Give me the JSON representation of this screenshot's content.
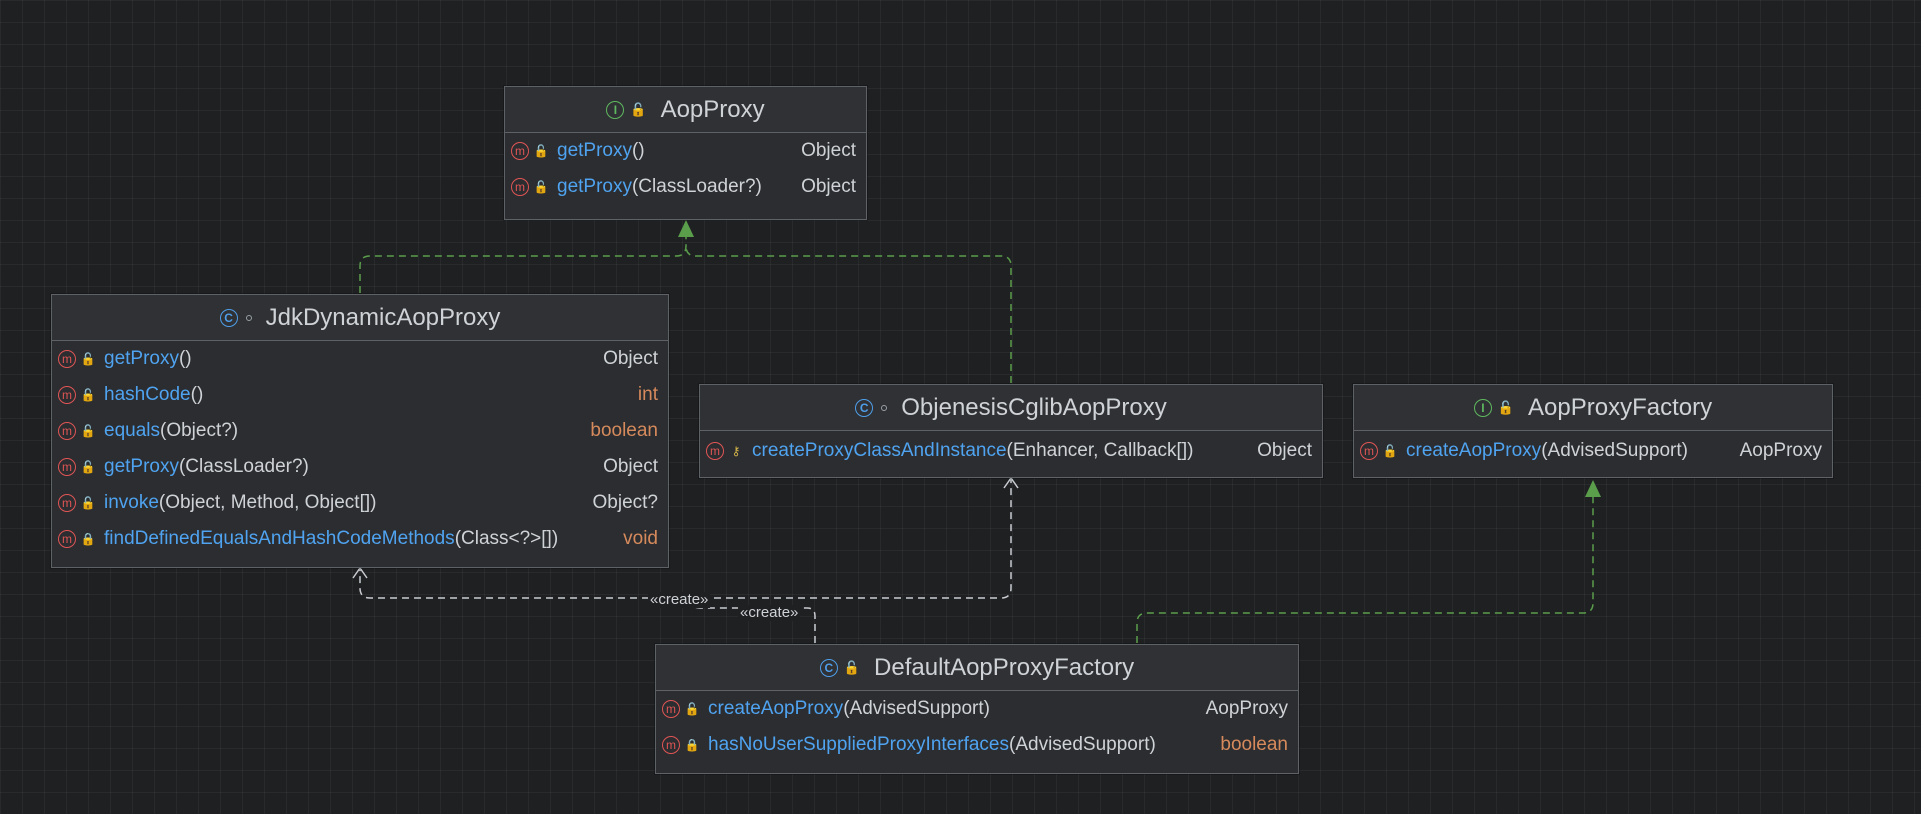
{
  "nodes": {
    "aop_proxy": {
      "kind": "interface",
      "title": "AopProxy",
      "methods": [
        {
          "name": "getProxy",
          "params": "()",
          "returns": "Object",
          "visibility": "public"
        },
        {
          "name": "getProxy",
          "params": "(ClassLoader?)",
          "returns": "Object",
          "visibility": "public"
        }
      ]
    },
    "jdk_dynamic_aop_proxy": {
      "kind": "class",
      "title": "JdkDynamicAopProxy",
      "methods": [
        {
          "name": "getProxy",
          "params": "()",
          "returns": "Object",
          "visibility": "public"
        },
        {
          "name": "hashCode",
          "params": "()",
          "returns": "int",
          "visibility": "public"
        },
        {
          "name": "equals",
          "params": "(Object?)",
          "returns": "boolean",
          "visibility": "public"
        },
        {
          "name": "getProxy",
          "params": "(ClassLoader?)",
          "returns": "Object",
          "visibility": "public"
        },
        {
          "name": "invoke",
          "params": "(Object, Method, Object[])",
          "returns": "Object?",
          "visibility": "public"
        },
        {
          "name": "findDefinedEqualsAndHashCodeMethods",
          "params": "(Class<?>[])",
          "returns": "void",
          "visibility": "private"
        }
      ]
    },
    "objenesis_cglib_aop_proxy": {
      "kind": "class",
      "title": "ObjenesisCglibAopProxy",
      "methods": [
        {
          "name": "createProxyClassAndInstance",
          "params": "(Enhancer, Callback[])",
          "returns": "Object",
          "visibility": "protected"
        }
      ]
    },
    "aop_proxy_factory": {
      "kind": "interface",
      "title": "AopProxyFactory",
      "methods": [
        {
          "name": "createAopProxy",
          "params": "(AdvisedSupport)",
          "returns": "AopProxy",
          "visibility": "public"
        }
      ]
    },
    "default_aop_proxy_factory": {
      "kind": "class",
      "title": "DefaultAopProxyFactory",
      "methods": [
        {
          "name": "createAopProxy",
          "params": "(AdvisedSupport)",
          "returns": "AopProxy",
          "visibility": "public"
        },
        {
          "name": "hasNoUserSuppliedProxyInterfaces",
          "params": "(AdvisedSupport)",
          "returns": "boolean",
          "visibility": "private"
        }
      ]
    }
  },
  "edges": {
    "create_label": "«create»"
  },
  "colors": {
    "background": "#1f2022",
    "implements_edge": "#5a9e4b",
    "dependency_edge": "#c9ccd1",
    "method_name": "#4fa3f0",
    "primitive_type": "#d68a5c"
  }
}
